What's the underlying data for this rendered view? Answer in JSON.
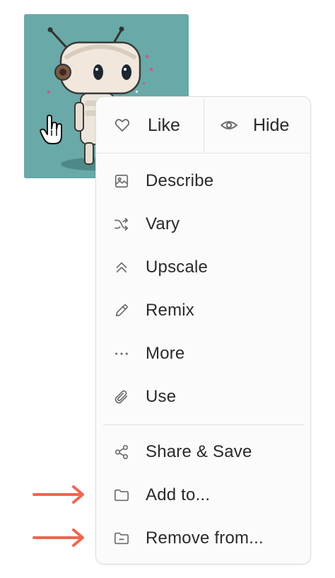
{
  "menu": {
    "like_label": "Like",
    "hide_label": "Hide",
    "items": [
      {
        "label": "Describe",
        "icon": "image-icon"
      },
      {
        "label": "Vary",
        "icon": "shuffle-icon"
      },
      {
        "label": "Upscale",
        "icon": "chevrons-up-icon"
      },
      {
        "label": "Remix",
        "icon": "pencil-icon"
      },
      {
        "label": "More",
        "icon": "ellipsis-icon"
      },
      {
        "label": "Use",
        "icon": "paperclip-icon"
      }
    ],
    "bottom_items": [
      {
        "label": "Share & Save",
        "icon": "share-icon"
      },
      {
        "label": "Add to...",
        "icon": "folder-icon"
      },
      {
        "label": "Remove from...",
        "icon": "folder-minus-icon"
      }
    ]
  },
  "colors": {
    "thumbnail_bg": "#69a9a7",
    "arrow": "#ef6650",
    "text": "#2a2a2a",
    "icon": "#6b6b6b"
  }
}
